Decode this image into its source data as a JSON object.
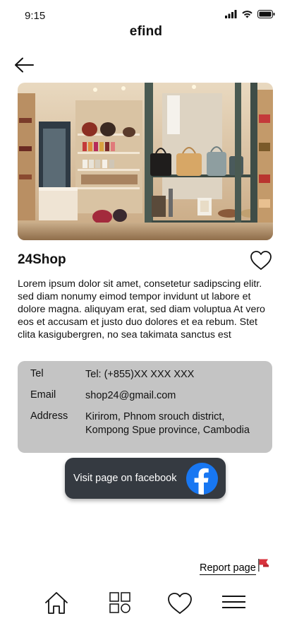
{
  "status_bar": {
    "time": "9:15"
  },
  "app": {
    "title": "efind"
  },
  "shop": {
    "name": "24Shop",
    "description": "Lorem ipsum dolor sit amet, consetetur sadipscing elitr. sed diam nonumy eimod tempor invidunt ut labore et dolore magna. aliquyam erat, sed diam voluptua At vero eos et accusam et justo duo dolores et ea rebum. Stet clita kasigubergren, no sea takimata sanctus est"
  },
  "contact": {
    "tel_label": "Tel",
    "tel_value": "Tel: (+855)XX XXX XXX",
    "email_label": "Email",
    "email_value": "shop24@gmail.com",
    "address_label": "Address",
    "address_value": "Kirirom, Phnom srouch district, Kompong Spue province, Cambodia"
  },
  "facebook_button": {
    "label": "Visit page on facebook"
  },
  "report": {
    "label": "Report page"
  },
  "icons": {
    "back": "arrow-left-icon",
    "favorite": "heart-outline-icon",
    "facebook": "facebook-logo-icon",
    "flag": "red-flag-icon",
    "nav": [
      "home-icon",
      "grid-icon",
      "heart-icon",
      "menu-icon"
    ]
  },
  "colors": {
    "card_bg": "#c4c4c4",
    "fb_button_bg": "#353a41",
    "facebook_blue": "#1877f2",
    "flag_red": "#d9323c"
  }
}
